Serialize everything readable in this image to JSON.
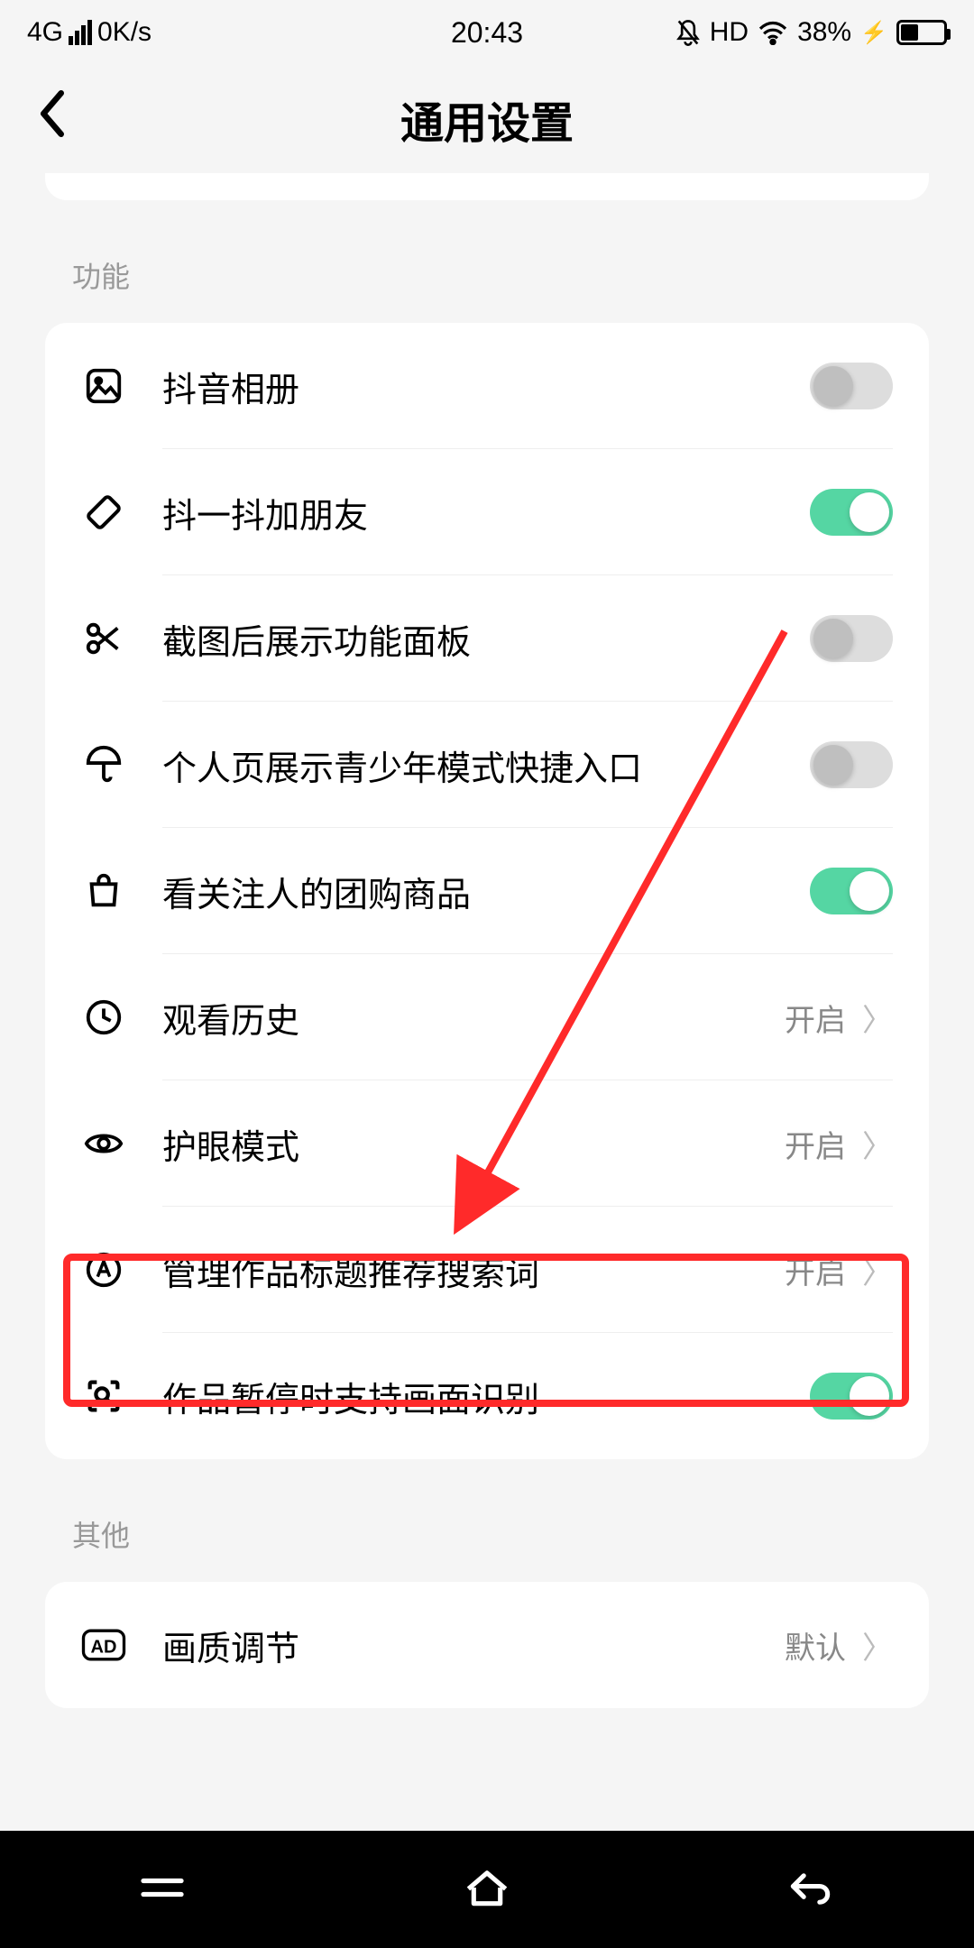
{
  "status": {
    "network": "4G",
    "speed": "0K/s",
    "time": "20:43",
    "hd": "HD",
    "battery_pct": "38%"
  },
  "header": {
    "title": "通用设置"
  },
  "sections": {
    "features_label": "功能",
    "other_label": "其他"
  },
  "rows": {
    "album": "抖音相册",
    "shake": "抖一抖加朋友",
    "screenshot": "截图后展示功能面板",
    "teenmode": "个人页展示青少年模式快捷入口",
    "groupbuy": "看关注人的团购商品",
    "history": "观看历史",
    "history_val": "开启",
    "eyecare": "护眼模式",
    "eyecare_val": "开启",
    "search_title": "管理作品标题推荐搜索词",
    "search_title_val": "开启",
    "pause_recog": "作品暂停时支持画面识别",
    "quality": "画质调节",
    "quality_val": "默认"
  },
  "annotation": {
    "highlight_row": "search_title",
    "arrow_to": "search_title"
  }
}
